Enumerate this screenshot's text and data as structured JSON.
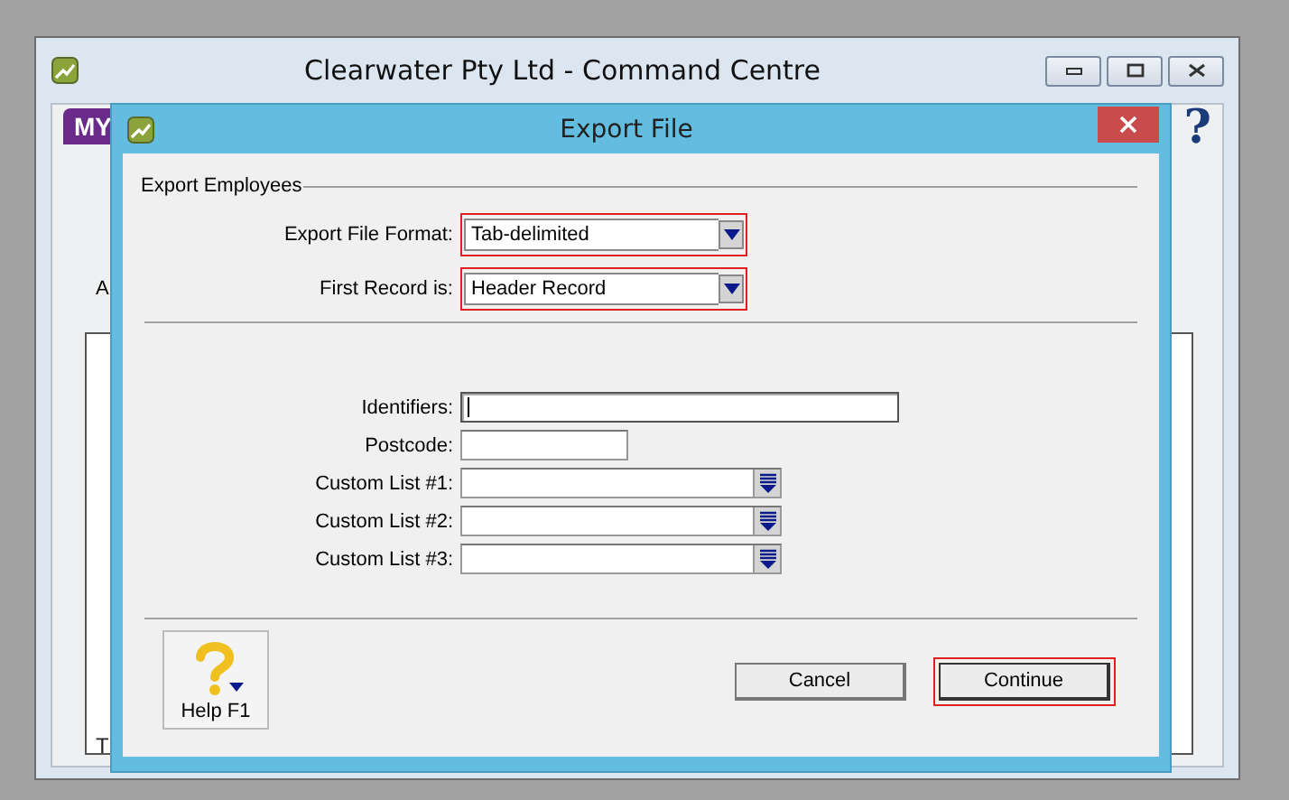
{
  "window": {
    "title": "Clearwater Pty Ltd - Command Centre",
    "logo_text": "MY",
    "help_glyph": "?",
    "fragments": [
      "A",
      "T"
    ]
  },
  "dialog": {
    "title": "Export File",
    "section": "Export Employees",
    "selects": [
      {
        "label": "Export File Format:",
        "value": "Tab-delimited",
        "highlighted": true
      },
      {
        "label": "First Record is:",
        "value": "Header Record",
        "highlighted": true
      }
    ],
    "filters": [
      {
        "kind": "text",
        "label": "Identifiers:",
        "focused": true
      },
      {
        "kind": "short",
        "label": "Postcode:",
        "focused": false
      },
      {
        "kind": "list",
        "label": "Custom List #1:",
        "focused": false
      },
      {
        "kind": "list",
        "label": "Custom List #2:",
        "focused": false
      },
      {
        "kind": "list",
        "label": "Custom List #3:",
        "focused": false
      }
    ],
    "help_button": "Help F1",
    "buttons": [
      {
        "label": "Cancel",
        "default": false
      },
      {
        "label": "Continue",
        "default": true
      }
    ]
  }
}
